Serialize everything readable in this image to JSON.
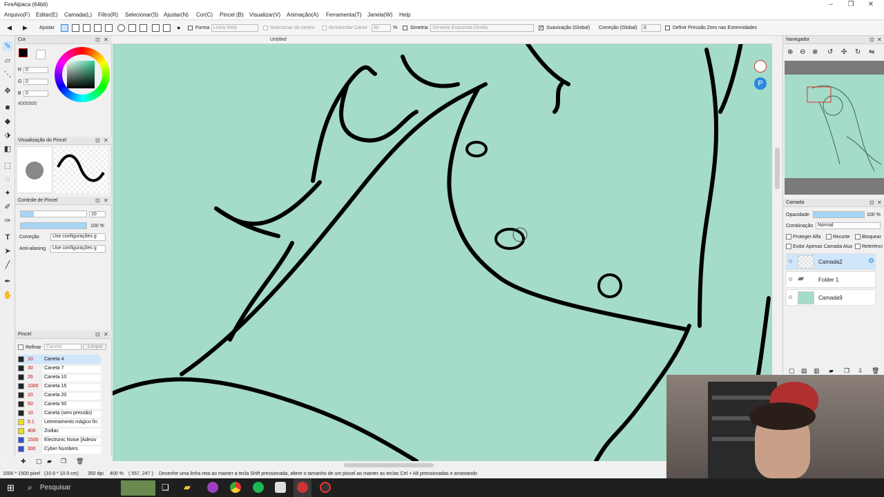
{
  "app": {
    "title": "FireAlpaca (64bit)"
  },
  "menu": [
    "Arquivo(F)",
    "Editar(E)",
    "Camada(L)",
    "Filtro(R)",
    "Selecionar(S)",
    "Ajustar(N)",
    "Cor(C)",
    "Pincel (B)",
    "Visualizar(V)",
    "Animação(A)",
    "Ferramenta(T)",
    "Janela(W)",
    "Help"
  ],
  "toolbar": {
    "ajustar": "Ajustar",
    "forma": "Forma",
    "forma_value": "Linha Reta",
    "selecionar_centro": "Selecionar do centro",
    "arredondar_canto": "Arredondar Canto",
    "arredondar_value": "80",
    "percent": "%",
    "simetria": "Simetria",
    "simetria_value": "Simetria Esquerda-Direita",
    "suavizacao": "Suavização (Global)",
    "correcao": "Correção (Global)",
    "correcao_value": "0",
    "pressao": "Definir Pressão Zero nas Extremidades"
  },
  "doc_tab": "Untitled",
  "color_panel": {
    "title": "Cor",
    "r_label": "R",
    "r_value": "0",
    "g_label": "G",
    "g_value": "0",
    "b_label": "B",
    "b_value": "0",
    "hex": "#000000"
  },
  "brush_preview": {
    "title": "Visualização do Pincel"
  },
  "brush_control": {
    "title": "Controle de Pincel",
    "size_value": "10",
    "opacity_value": "100 %",
    "correcao_label": "Correção",
    "correcao_value": "Use configurações g",
    "antialias_label": "Anti-aliasing",
    "antialias_value": "Use configurações g"
  },
  "brush_panel": {
    "title": "Pincel",
    "refinar": "Refinar",
    "search_placeholder": "Caneta",
    "limpar": "Limpar",
    "brushes": [
      {
        "size": "10",
        "name": "Caneta 4",
        "color": "#222222"
      },
      {
        "size": "30",
        "name": "Caneta 7",
        "color": "#222222"
      },
      {
        "size": "26",
        "name": "Caneta 10",
        "color": "#222222"
      },
      {
        "size": "1000",
        "name": "Caneta 15",
        "color": "#222222"
      },
      {
        "size": "20",
        "name": "Caneta 20",
        "color": "#222222"
      },
      {
        "size": "50",
        "name": "Caneta 50",
        "color": "#222222"
      },
      {
        "size": "10",
        "name": "Caneta (sem pressão)",
        "color": "#222222"
      },
      {
        "size": "0.1",
        "name": "Letreiramento mágico fin",
        "color": "#e8e020"
      },
      {
        "size": "400",
        "name": "Zodiac",
        "color": "#e8e020"
      },
      {
        "size": "1500",
        "name": "Electronic Noise [Adesiv",
        "color": "#3050d0"
      },
      {
        "size": "300",
        "name": "Cyber Numbers",
        "color": "#3050d0"
      }
    ]
  },
  "navigator": {
    "title": "Navegador"
  },
  "layer_panel": {
    "title": "Camada",
    "opacity_label": "Opacidade",
    "opacity_value": "100 %",
    "blend_label": "Combinação",
    "blend_value": "Normal",
    "protect_alpha": "Proteger Alfa",
    "clip": "Recorte",
    "lock": "Bloquear",
    "show_only": "Exibir Apenas Camada Atual",
    "reference": "Referência",
    "layers": [
      {
        "name": "Camada2",
        "selected": true
      },
      {
        "name": "Folder 1",
        "selected": false
      },
      {
        "name": "Camada9",
        "selected": false
      }
    ]
  },
  "status": {
    "size": "1500 * 1500 pixel",
    "cm": "(10.9 * 10.9 cm)",
    "dpi": "350 dpi",
    "zoom": "400 %",
    "coords": "( 557, 247 )",
    "hint": "Desenhe uma linha reta ao manter a tecla Shift pressionada, altere o tamanho de um pincel ao manter as teclas Ctrl + Alt pressionadas e arrastando"
  },
  "taskbar": {
    "search": "Pesquisar"
  },
  "colors": {
    "canvas": "#a5dbc9",
    "accent": "#2a88e0",
    "taskbar": "#1f1f1f"
  }
}
